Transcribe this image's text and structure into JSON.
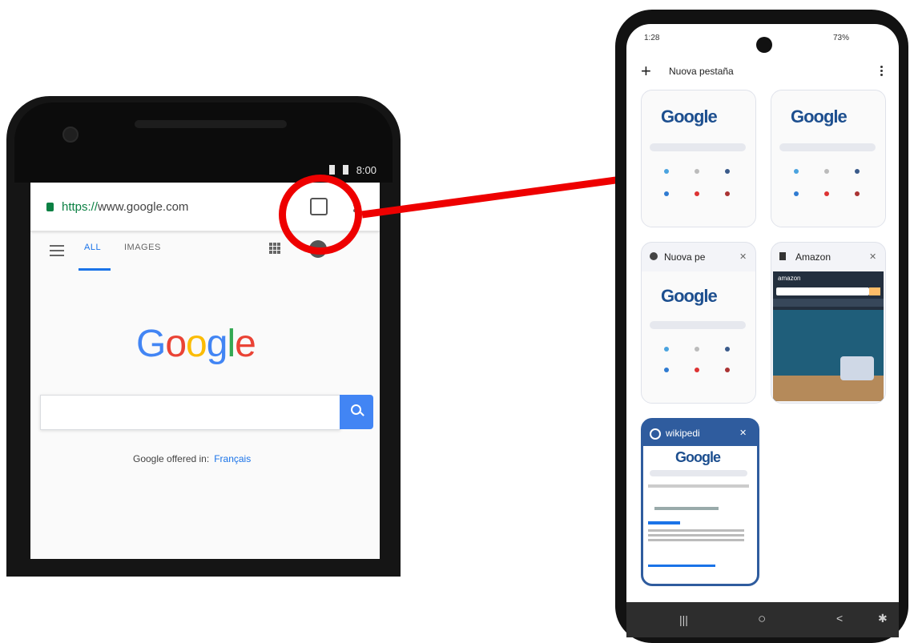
{
  "left_phone": {
    "status": {
      "time": "8:00"
    },
    "address_bar": {
      "scheme": "https://",
      "host": "www.google.com"
    },
    "nav": {
      "tab_all": "ALL",
      "tab_images": "IMAGES"
    },
    "logo": {
      "letters": [
        {
          "ch": "G",
          "color": "#4285f4"
        },
        {
          "ch": "o",
          "color": "#ea4335"
        },
        {
          "ch": "o",
          "color": "#fbbc05"
        },
        {
          "ch": "g",
          "color": "#4285f4"
        },
        {
          "ch": "l",
          "color": "#34a853"
        },
        {
          "ch": "e",
          "color": "#ea4335"
        }
      ]
    },
    "offered": {
      "text": "Google offered in:",
      "language": "Français"
    }
  },
  "annotation": {
    "color": "#ee0000"
  },
  "right_phone": {
    "status_left": "1:28",
    "status_right": "73%",
    "header": {
      "new_tab_symbol": "+",
      "title": "Nuova pestaña"
    },
    "tabs": [
      {
        "title": "",
        "doodle": "Google"
      },
      {
        "title": "",
        "doodle": "Google"
      },
      {
        "title": "Nuova pe",
        "doodle": "Google"
      },
      {
        "title": "Amazon",
        "doodle": ""
      },
      {
        "title": "wikipedi",
        "doodle": "Google"
      }
    ],
    "amazon_preview": {
      "brand": "amazon"
    },
    "nav_bar": {
      "recent": "|||",
      "home": "○",
      "back": "<"
    }
  }
}
